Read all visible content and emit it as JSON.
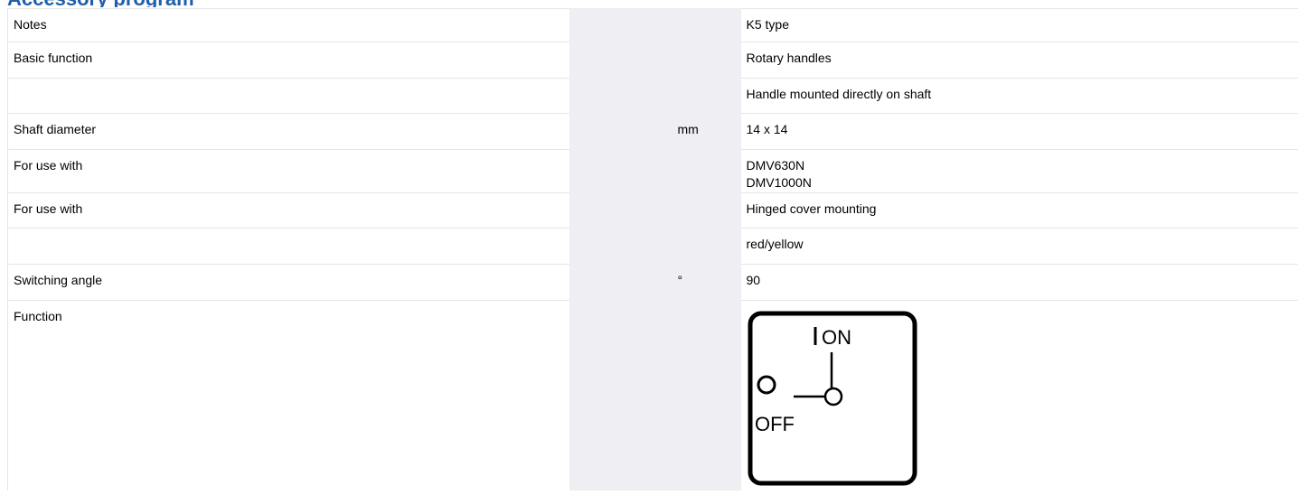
{
  "heading": "Accessory program",
  "rows": [
    {
      "label": "Notes",
      "unit": "",
      "value": "K5 type"
    },
    {
      "label": "Basic function",
      "unit": "",
      "value": "Rotary handles"
    },
    {
      "label": "",
      "unit": "",
      "value": "Handle mounted directly on shaft"
    },
    {
      "label": "Shaft diameter",
      "unit": "mm",
      "value": "14 x 14"
    },
    {
      "label": "For use with",
      "unit": "",
      "values": [
        "DMV630N",
        "DMV1000N"
      ]
    },
    {
      "label": "For use with",
      "unit": "",
      "value": "Hinged cover mounting"
    },
    {
      "label": "",
      "unit": "",
      "value": "red/yellow"
    },
    {
      "label": "Switching angle",
      "unit": "°",
      "value": "90"
    },
    {
      "label": "Function",
      "unit": "",
      "diagram": {
        "on_label": "ON",
        "off_label": "OFF"
      }
    }
  ]
}
